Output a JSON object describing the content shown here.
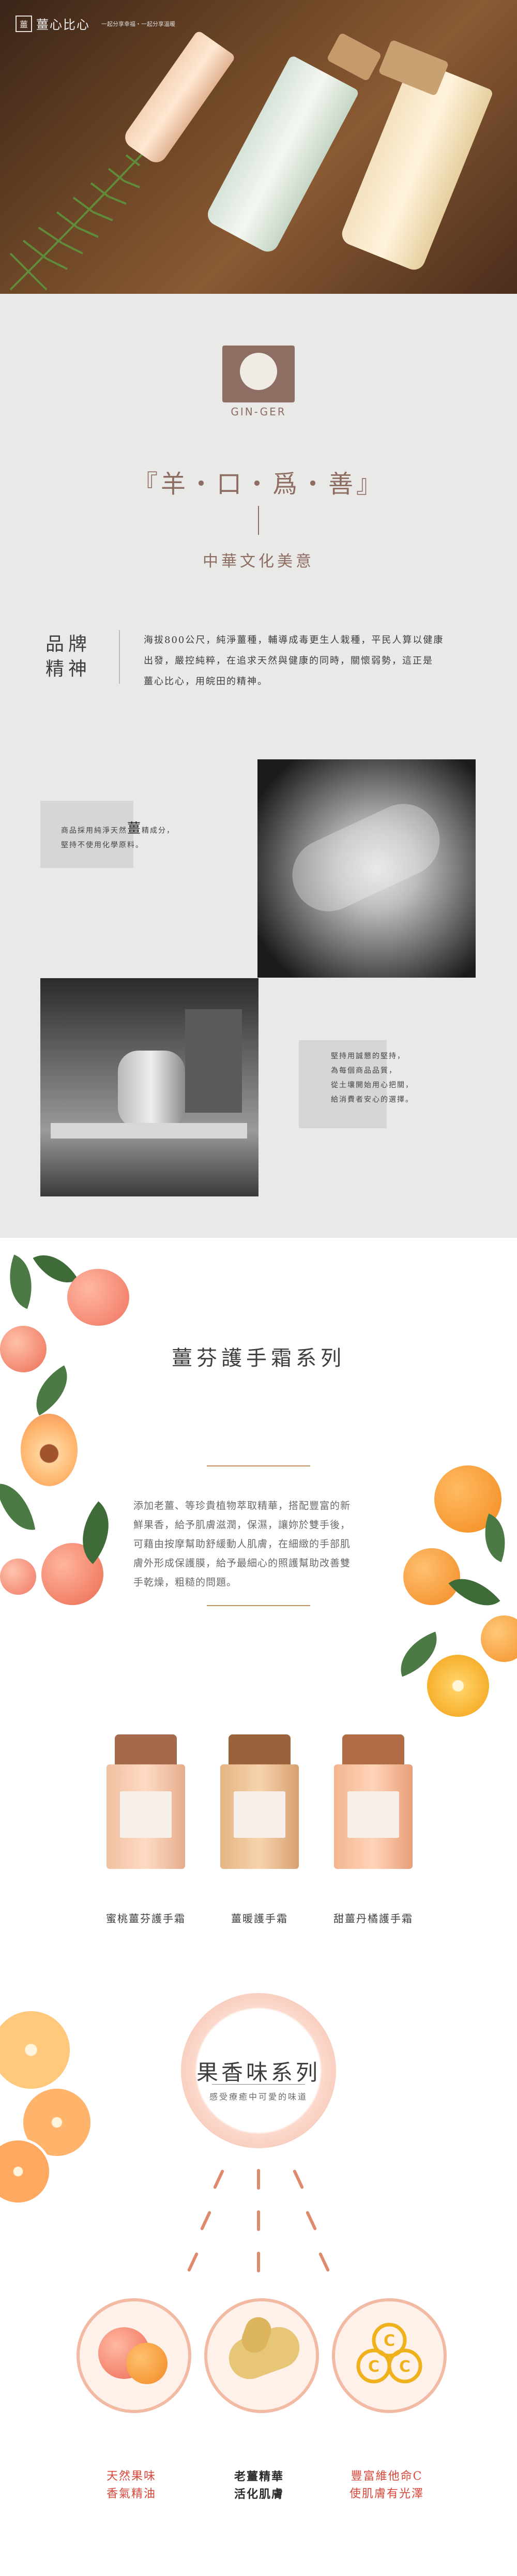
{
  "header": {
    "logo_icon": "薑",
    "logo_text": "薑心比心",
    "tagline": "一起分享幸福・一起分享溫暖"
  },
  "brand": {
    "logo_text": "GIN-GER",
    "motto": "『羊・口・爲・善』",
    "subtitle": "中華文化美意",
    "spirit_title_1": "品牌",
    "spirit_title_2": "精神",
    "spirit_body_1": "海拔800公尺，純淨薑種，輔導成毒更生人栽種，平民人算以健康",
    "spirit_body_2": "出發，嚴控純粹，在追求天然與健康的同時，關懷弱勢，這正是",
    "spirit_body_3": "薑心比心，用皖田的精神。",
    "box1_line1": "商品採用純淨天然",
    "box1_highlight": "薑",
    "box1_line1_end": "精成分，",
    "box1_line2": "堅持不使用化學原料。",
    "box2_line1": "堅持用誠懇的堅持，",
    "box2_line2": "為每個商品品質，",
    "box2_line3": "從土壤開始用心把關，",
    "box2_line4": "給消費者安心的選擇。"
  },
  "series": {
    "title": "薑芬護手霜系列",
    "desc_1": "添加老薑、等珍貴植物萃取精華，搭配豐富的新",
    "desc_2": "鮮果香，給予肌膚滋潤，保濕，讓妳於雙手後，",
    "desc_3": "可藉由按摩幫助舒緩動人肌膚，在細緻的手部肌",
    "desc_4": "膚外形成保護膜，給予最細心的照護幫助改善雙",
    "desc_4b": "手乾燥，粗糙的問題。",
    "products": [
      {
        "name": "蜜桃薑芬護手霜"
      },
      {
        "name": "薑暖護手霜"
      },
      {
        "name": "甜薑丹橘護手霜"
      }
    ],
    "fruity_title": "果香味系列",
    "fruity_sub": "感受療癒中可愛的味道",
    "features": [
      {
        "line1": "天然果味",
        "line2": "香氣精油"
      },
      {
        "line1": "老薑精華",
        "line2": "活化肌膚"
      },
      {
        "line1": "豐富維他命C",
        "line2": "使肌膚有光澤"
      }
    ]
  },
  "colors": {
    "brand_brown": "#8e6d62",
    "accent_orange": "#e08a6d",
    "feature_red": "#d9473a"
  }
}
